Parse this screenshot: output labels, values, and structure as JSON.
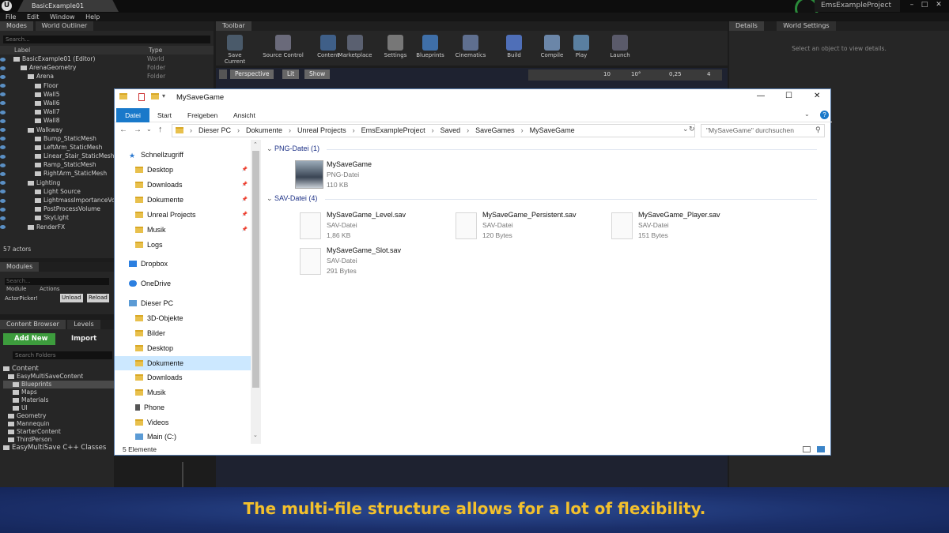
{
  "editor": {
    "tab_title": "BasicExample01",
    "menu": [
      "File",
      "Edit",
      "Window",
      "Help"
    ],
    "project_name": "EmsExampleProject",
    "modes_tab": "Modes",
    "outliner_tab": "World Outliner",
    "toolbar_tab": "Toolbar",
    "details_tab": "Details",
    "world_settings_tab": "World Settings",
    "details_placeholder": "Select an object to view details.",
    "search_placeholder": "Search...",
    "outliner_columns": [
      "Label",
      "Type"
    ],
    "outliner_rows": [
      {
        "label": "BasicExample01 (Editor)",
        "type": "World"
      },
      {
        "label": "ArenaGeometry",
        "type": "Folder"
      },
      {
        "label": "Arena",
        "type": "Folder"
      },
      {
        "label": "Floor",
        "type": ""
      },
      {
        "label": "Wall5",
        "type": ""
      },
      {
        "label": "Wall6",
        "type": ""
      },
      {
        "label": "Wall7",
        "type": ""
      },
      {
        "label": "Wall8",
        "type": ""
      },
      {
        "label": "Walkway",
        "type": ""
      },
      {
        "label": "Bump_StaticMesh",
        "type": ""
      },
      {
        "label": "LeftArm_StaticMesh",
        "type": ""
      },
      {
        "label": "Linear_Stair_StaticMesh",
        "type": ""
      },
      {
        "label": "Ramp_StaticMesh",
        "type": ""
      },
      {
        "label": "RightArm_StaticMesh",
        "type": ""
      },
      {
        "label": "Lighting",
        "type": ""
      },
      {
        "label": "Light Source",
        "type": ""
      },
      {
        "label": "LightmassImportanceVolu",
        "type": ""
      },
      {
        "label": "PostProcessVolume",
        "type": ""
      },
      {
        "label": "SkyLight",
        "type": ""
      },
      {
        "label": "RenderFX",
        "type": ""
      }
    ],
    "actor_count": "57 actors",
    "modules_tab": "Modules",
    "modules_cols": [
      "Module",
      "Actions"
    ],
    "modules_row": "ActorPicker!",
    "unload_label": "Unload",
    "reload_label": "Reload",
    "content_browser_tab": "Content Browser",
    "levels_tab": "Levels",
    "add_new_label": "Add New",
    "import_label": "Import",
    "search_folders": "Search Folders",
    "content_tree": [
      "Content",
      "EasyMultiSaveContent",
      "Blueprints",
      "Maps",
      "Materials",
      "UI",
      "Geometry",
      "Mannequin",
      "StarterContent",
      "ThirdPerson",
      "EasyMultiSave C++ Classes"
    ],
    "toolbar_buttons": [
      "Save Current",
      "Source Control",
      "Content",
      "Marketplace",
      "Settings",
      "Blueprints",
      "Cinematics",
      "Build",
      "Compile",
      "Play",
      "Launch"
    ],
    "viewport_buttons": [
      "Perspective",
      "Lit",
      "Show"
    ],
    "viewport_values": [
      "10",
      "10°",
      "0,25",
      "4"
    ]
  },
  "explorer": {
    "title": "MySaveGame",
    "ribbon_tabs": [
      "Datei",
      "Start",
      "Freigeben",
      "Ansicht"
    ],
    "breadcrumb": [
      "Dieser PC",
      "Dokumente",
      "Unreal Projects",
      "EmsExampleProject",
      "Saved",
      "SaveGames",
      "MySaveGame"
    ],
    "search_placeholder": "\"MySaveGame\" durchsuchen",
    "nav": [
      {
        "label": "Schnellzugriff",
        "pinned": false
      },
      {
        "label": "Desktop",
        "pinned": true
      },
      {
        "label": "Downloads",
        "pinned": true
      },
      {
        "label": "Dokumente",
        "pinned": true
      },
      {
        "label": "Unreal Projects",
        "pinned": true
      },
      {
        "label": "Musik",
        "pinned": true
      },
      {
        "label": "Logs",
        "pinned": false
      },
      {
        "label": "Dropbox",
        "pinned": false
      },
      {
        "label": "OneDrive",
        "pinned": false
      },
      {
        "label": "Dieser PC",
        "pinned": false
      },
      {
        "label": "3D-Objekte",
        "pinned": false
      },
      {
        "label": "Bilder",
        "pinned": false
      },
      {
        "label": "Desktop",
        "pinned": false
      },
      {
        "label": "Dokumente",
        "pinned": false
      },
      {
        "label": "Downloads",
        "pinned": false
      },
      {
        "label": "Musik",
        "pinned": false
      },
      {
        "label": "Phone",
        "pinned": false
      },
      {
        "label": "Videos",
        "pinned": false
      },
      {
        "label": "Main (C:)",
        "pinned": false
      }
    ],
    "groups": [
      {
        "header": "PNG-Datei (1)",
        "files": [
          {
            "name": "MySaveGame",
            "type": "PNG-Datei",
            "size": "110 KB"
          }
        ]
      },
      {
        "header": "SAV-Datei (4)",
        "files": [
          {
            "name": "MySaveGame_Level.sav",
            "type": "SAV-Datei",
            "size": "1,86 KB"
          },
          {
            "name": "MySaveGame_Persistent.sav",
            "type": "SAV-Datei",
            "size": "120 Bytes"
          },
          {
            "name": "MySaveGame_Player.sav",
            "type": "SAV-Datei",
            "size": "151 Bytes"
          },
          {
            "name": "MySaveGame_Slot.sav",
            "type": "SAV-Datei",
            "size": "291 Bytes"
          }
        ]
      }
    ],
    "status": "5 Elemente"
  },
  "caption": "The multi-file structure allows for a lot of flexibility."
}
